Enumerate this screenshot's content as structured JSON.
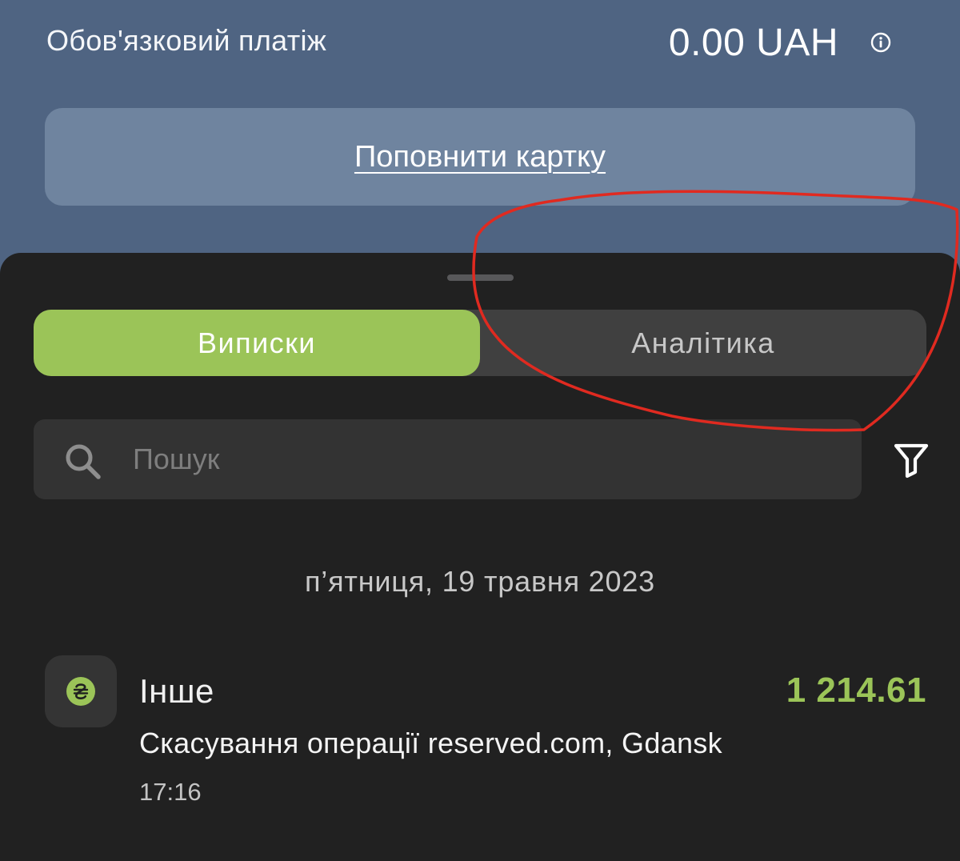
{
  "header": {
    "mandatory_payment_label": "Обов'язковий платіж",
    "mandatory_payment_amount": "0.00 UAH",
    "info_icon": "info-circle-icon",
    "topup_button_label": "Поповнити картку"
  },
  "tabs": [
    {
      "label": "Виписки",
      "active": true
    },
    {
      "label": "Аналітика",
      "active": false
    }
  ],
  "search": {
    "placeholder": "Пошук",
    "value": "",
    "icon": "search-icon"
  },
  "filter": {
    "icon": "filter-funnel-icon"
  },
  "statement": {
    "date_header": "п’ятниця, 19 травня 2023",
    "transactions": [
      {
        "icon": "hryvnia-icon",
        "category": "Інше",
        "amount": "1 214.61",
        "description": "Скасування операції reserved.com, Gdansk",
        "time": "17:16"
      }
    ]
  },
  "colors": {
    "header_background": "#4f6482",
    "sheet_background": "#212121",
    "accent_green": "#9bc458",
    "annotation_red": "#e02a20"
  },
  "annotation": {
    "shape": "hand-drawn red circle",
    "highlights": "tab-analytics"
  }
}
